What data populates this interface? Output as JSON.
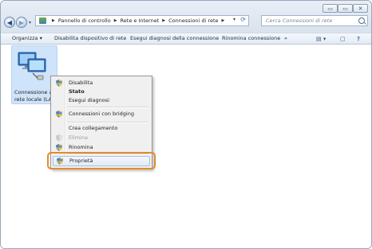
{
  "window": {
    "controls": {
      "minimize": "▭",
      "maximize": "▭",
      "close": "✕"
    }
  },
  "nav": {
    "back_glyph": "◀",
    "forward_glyph": "▶",
    "recent_glyph": "▾"
  },
  "address": {
    "breadcrumbs": [
      "Pannello di controllo",
      "Rete e Internet",
      "Connessioni di rete"
    ],
    "separator": "▶",
    "dropdown_glyph": "▾",
    "refresh_glyph": "⟳"
  },
  "search": {
    "placeholder": "Cerca Connessioni di rete"
  },
  "toolbar": {
    "organize": "Organizza ▾",
    "disable_device": "Disabilita dispositivo di rete",
    "diagnose": "Esegui diagnosi della connessione",
    "rename": "Rinomina connessione",
    "more": "»",
    "view_glyph": "▤ ▾",
    "pane_glyph": "▢",
    "help_glyph": "?"
  },
  "connection": {
    "label_line1": "Connessione alla",
    "label_line2": "rete locale (LAN)"
  },
  "context_menu": {
    "items": [
      {
        "label": "Disabilita",
        "icon": "shield-icon",
        "bold": false,
        "disabled": false
      },
      {
        "label": "Stato",
        "icon": "",
        "bold": true,
        "disabled": false
      },
      {
        "label": "Esegui diagnosi",
        "icon": "",
        "bold": false,
        "disabled": false
      },
      {
        "label": "Connessioni con bridging",
        "icon": "shield-icon",
        "bold": false,
        "disabled": false
      },
      {
        "label": "Crea collegamento",
        "icon": "",
        "bold": false,
        "disabled": false
      },
      {
        "label": "Elimina",
        "icon": "shield-icon",
        "bold": false,
        "disabled": true
      },
      {
        "label": "Rinomina",
        "icon": "shield-icon",
        "bold": false,
        "disabled": false
      },
      {
        "label": "Proprietà",
        "icon": "shield-icon",
        "bold": false,
        "disabled": false,
        "highlighted": true
      }
    ]
  },
  "colors": {
    "highlight_outline": "#e58a2c",
    "selection": "#cfe4fa"
  }
}
